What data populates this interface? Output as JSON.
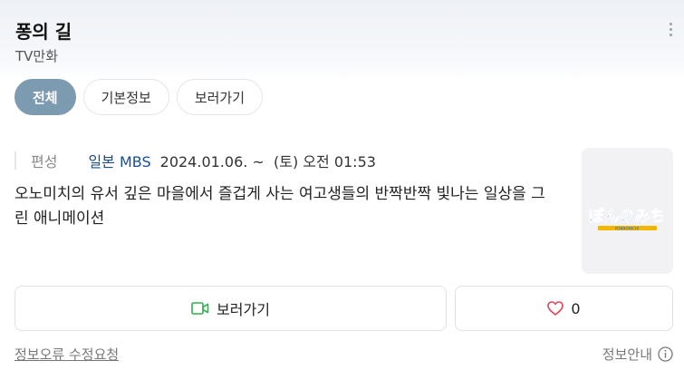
{
  "header": {
    "title": "퐁의 길",
    "subtitle": "TV만화"
  },
  "tabs": [
    {
      "label": "전체",
      "active": true
    },
    {
      "label": "기본정보",
      "active": false
    },
    {
      "label": "보러가기",
      "active": false
    }
  ],
  "info": {
    "label": "편성",
    "broadcaster": "일본 MBS",
    "schedule": "2024.01.06. ~  (토) 오전 01:53"
  },
  "description": "오노미치의 유서 깊은 마을에서 즐겁게 사는 여고생들의 반짝반짝 빛나는 일상을 그린 애니메이션",
  "thumbnail": {
    "logo_text": "ぽんのみち",
    "logo_subtext": "PONNOMICHI",
    "colors": {
      "blue": "#1d6fd1",
      "pink": "#e84a8a",
      "gold": "#f2b600"
    }
  },
  "actions": {
    "watch_label": "보러가기",
    "watch_icon": "video-camera-icon",
    "like_icon": "heart-icon",
    "like_count": "0"
  },
  "footer": {
    "report_label": "정보오류 수정요청",
    "info_label": "정보안내",
    "info_icon": "info-icon"
  },
  "colors": {
    "active_tab": "#7c9ab0",
    "link": "#1a4d8f",
    "watch_icon": "#2fb24c",
    "heart": "#e0455a"
  }
}
